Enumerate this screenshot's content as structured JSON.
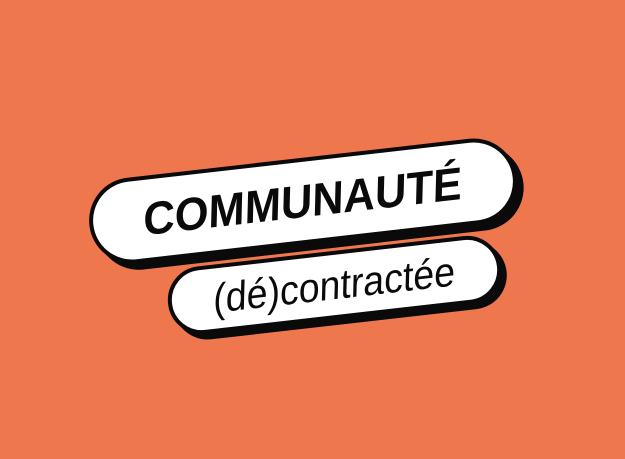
{
  "colors": {
    "background": "#ee774e",
    "pill_fill": "#ffffff",
    "outline": "#0a0a0a",
    "text": "#0a0a0a"
  },
  "logo": {
    "line_1": "COMMUNAUTÉ",
    "line_2": "(dé)contractée"
  }
}
